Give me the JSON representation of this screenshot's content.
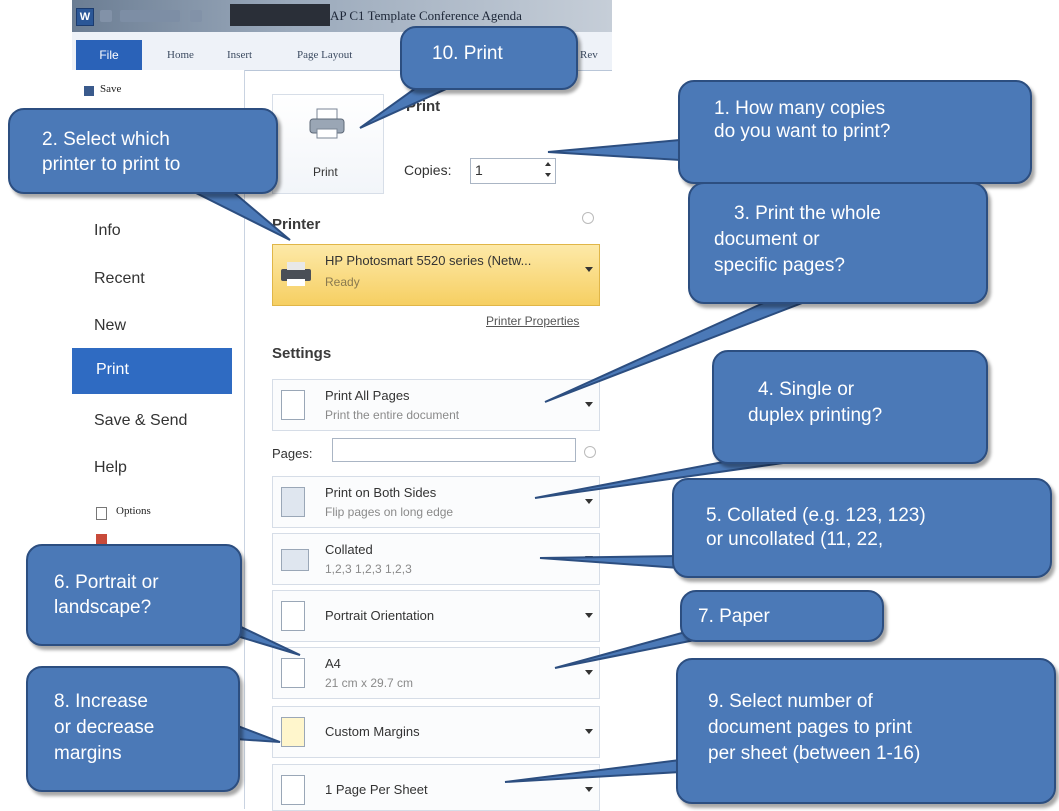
{
  "window": {
    "title": "ICAP C1 Template Conference Agenda",
    "app_icon": "W"
  },
  "ribbon": {
    "tabs": [
      "File",
      "Home",
      "Insert",
      "Page Layout",
      "Rev"
    ]
  },
  "backstage": {
    "save": "Save",
    "items": [
      "Info",
      "Recent",
      "New",
      "Print",
      "Save & Send",
      "Help"
    ],
    "options": "Options"
  },
  "print_panel": {
    "header": "Print",
    "print_button": "Print",
    "copies_label": "Copies:",
    "copies_value": "1",
    "printer_section": "Printer",
    "printer_name": "HP Photosmart 5520 series (Netw...",
    "printer_status": "Ready",
    "printer_properties": "Printer Properties",
    "settings_section": "Settings",
    "pages_label": "Pages:",
    "pages_value": "",
    "settings": [
      {
        "title": "Print All Pages",
        "subtitle": "Print the entire document"
      },
      {
        "title": "Print on Both Sides",
        "subtitle": "Flip pages on long edge"
      },
      {
        "title": "Collated",
        "subtitle": "1,2,3   1,2,3   1,2,3"
      },
      {
        "title": "Portrait Orientation",
        "subtitle": ""
      },
      {
        "title": "A4",
        "subtitle": "21 cm x 29.7 cm"
      },
      {
        "title": "Custom Margins",
        "subtitle": ""
      },
      {
        "title": "1 Page Per Sheet",
        "subtitle": ""
      }
    ]
  },
  "callouts": {
    "c1": [
      "1. How many copies",
      "do you want to print?"
    ],
    "c2": [
      "2. Select which",
      "printer to print to"
    ],
    "c3": [
      "3. Print the whole",
      "document or",
      "specific pages?"
    ],
    "c4": [
      "4. Single or",
      "duplex printing?"
    ],
    "c5": [
      "5. Collated (e.g. 123, 123)",
      "or uncollated (11, 22,"
    ],
    "c6": [
      "6. Portrait or",
      "landscape?"
    ],
    "c7": [
      "7. Paper"
    ],
    "c8": [
      "8. Increase",
      "or decrease",
      "margins"
    ],
    "c9": [
      "9. Select number of",
      "document pages to print",
      "per sheet (between 1-16)"
    ],
    "c10": [
      "10. Print"
    ]
  },
  "colors": {
    "callout_fill": "#4b79b7",
    "callout_border": "#2c4e80",
    "file_tab": "#2a62b8",
    "printer_highlight": "#f7d36b"
  }
}
